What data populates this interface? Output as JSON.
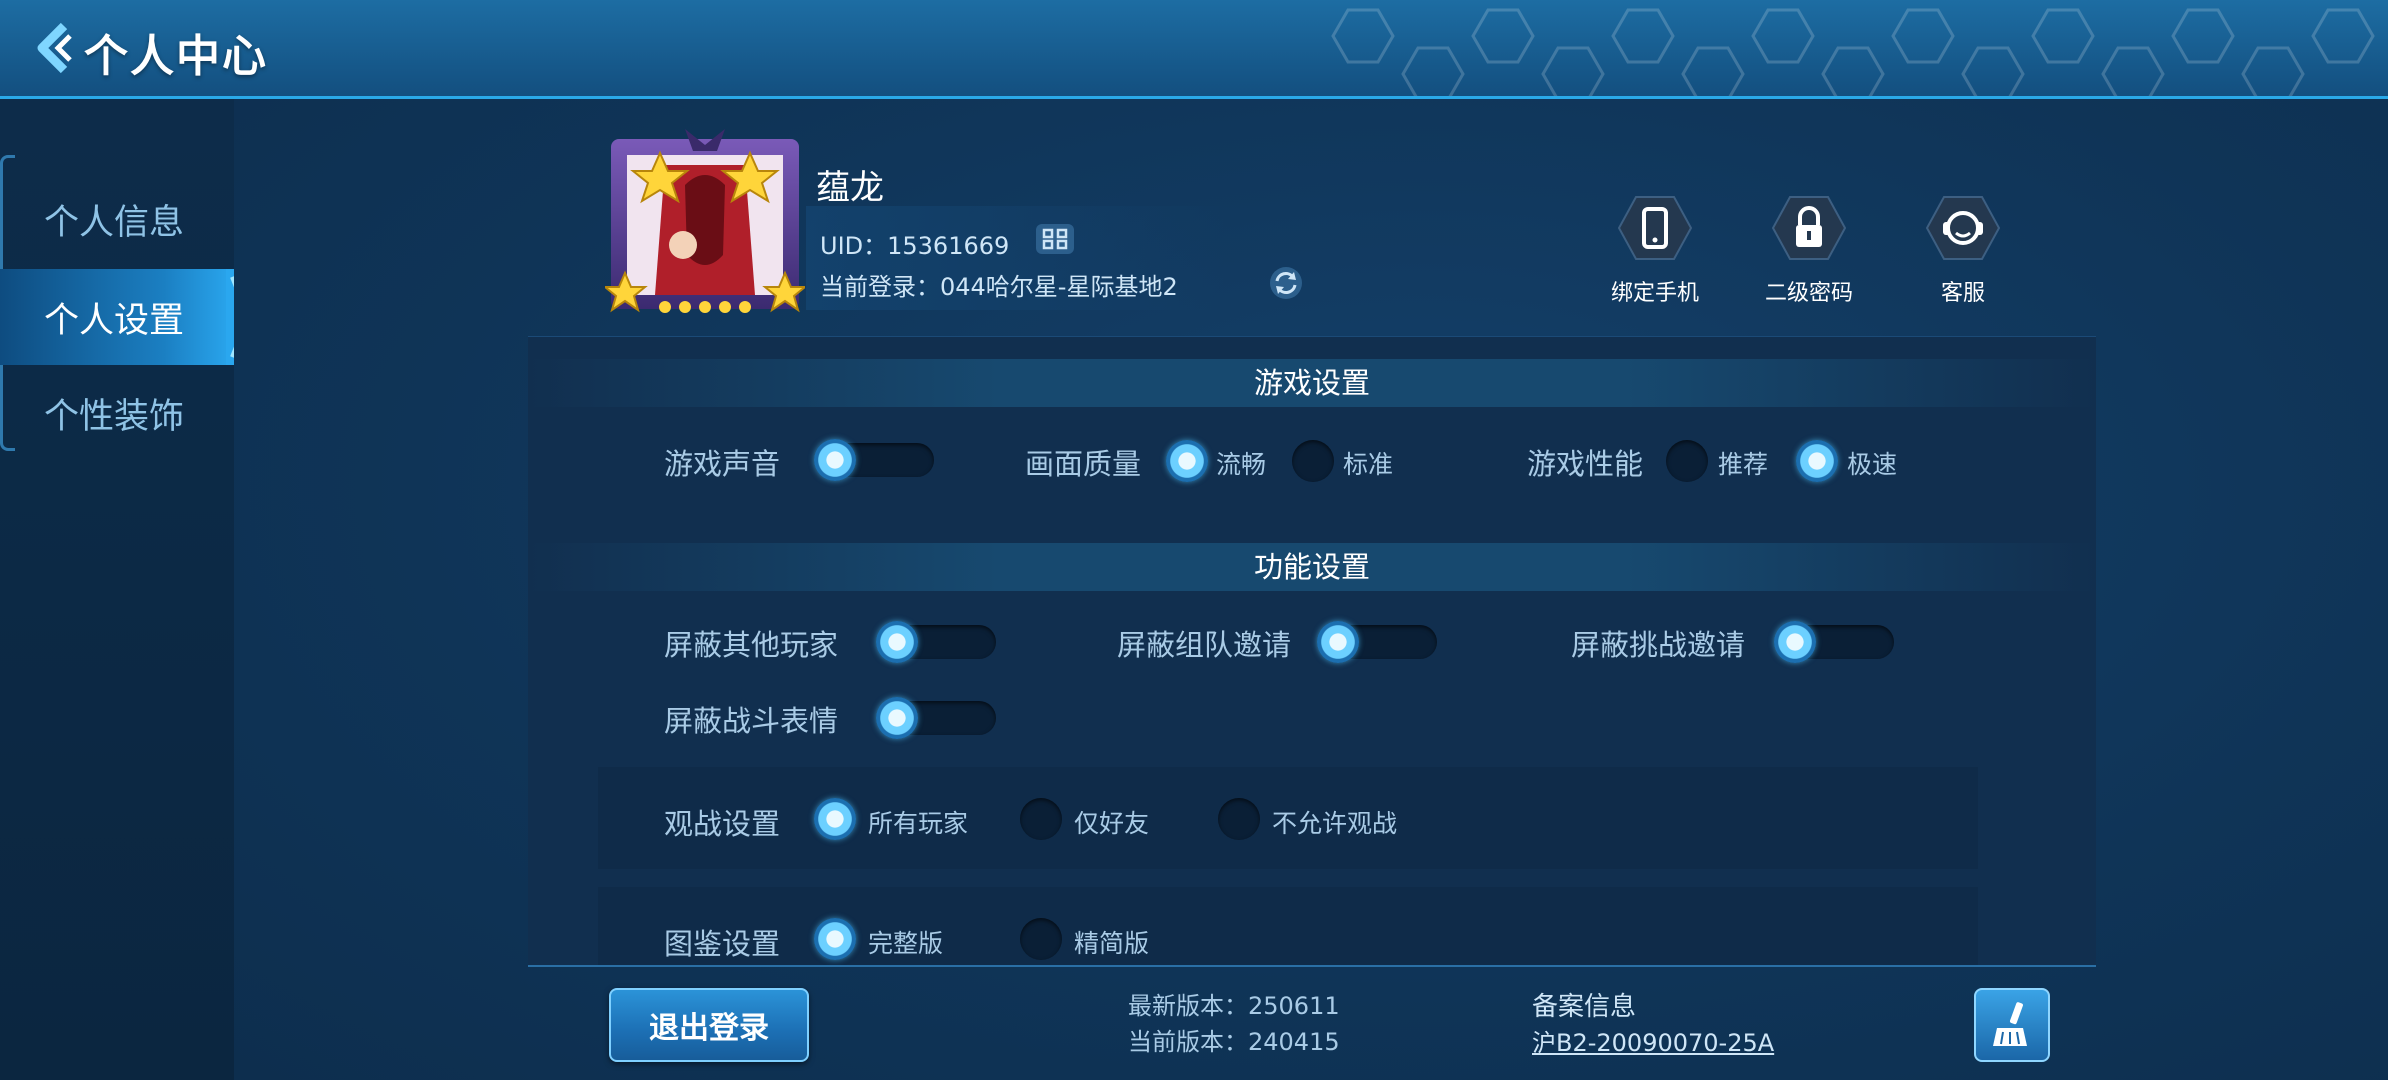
{
  "header": {
    "title": "个人中心"
  },
  "sidebar": {
    "items": [
      {
        "label": "个人信息"
      },
      {
        "label": "个人设置"
      },
      {
        "label": "个性装饰"
      }
    ]
  },
  "profile": {
    "nickname": "蕴龙",
    "uid_text": "UID：15361669",
    "login_text": "当前登录：044哈尔星-星际基地2"
  },
  "quick_actions": [
    {
      "label": "绑定手机",
      "icon": "phone-icon"
    },
    {
      "label": "二级密码",
      "icon": "lock-icon"
    },
    {
      "label": "客服",
      "icon": "headset-icon"
    }
  ],
  "game_settings": {
    "title": "游戏设置",
    "sound_label": "游戏声音",
    "quality_label": "画面质量",
    "quality_options": [
      "流畅",
      "标准"
    ],
    "performance_label": "游戏性能",
    "performance_options": [
      "推荐",
      "极速"
    ]
  },
  "function_settings": {
    "title": "功能设置",
    "toggles": [
      "屏蔽其他玩家",
      "屏蔽组队邀请",
      "屏蔽挑战邀请",
      "屏蔽战斗表情"
    ]
  },
  "spectate": {
    "label": "观战设置",
    "options": [
      "所有玩家",
      "仅好友",
      "不允许观战"
    ]
  },
  "album": {
    "label": "图鉴设置",
    "options": [
      "完整版",
      "精简版"
    ]
  },
  "footer": {
    "logout_label": "退出登录",
    "latest_version": "最新版本：250611",
    "current_version": "当前版本：240415",
    "record_title": "备案信息",
    "record_number": "沪B2-20090070-25A"
  },
  "colors": {
    "accent": "#2aa7ef",
    "header": "#1d6da3",
    "background": "#0e3152"
  }
}
